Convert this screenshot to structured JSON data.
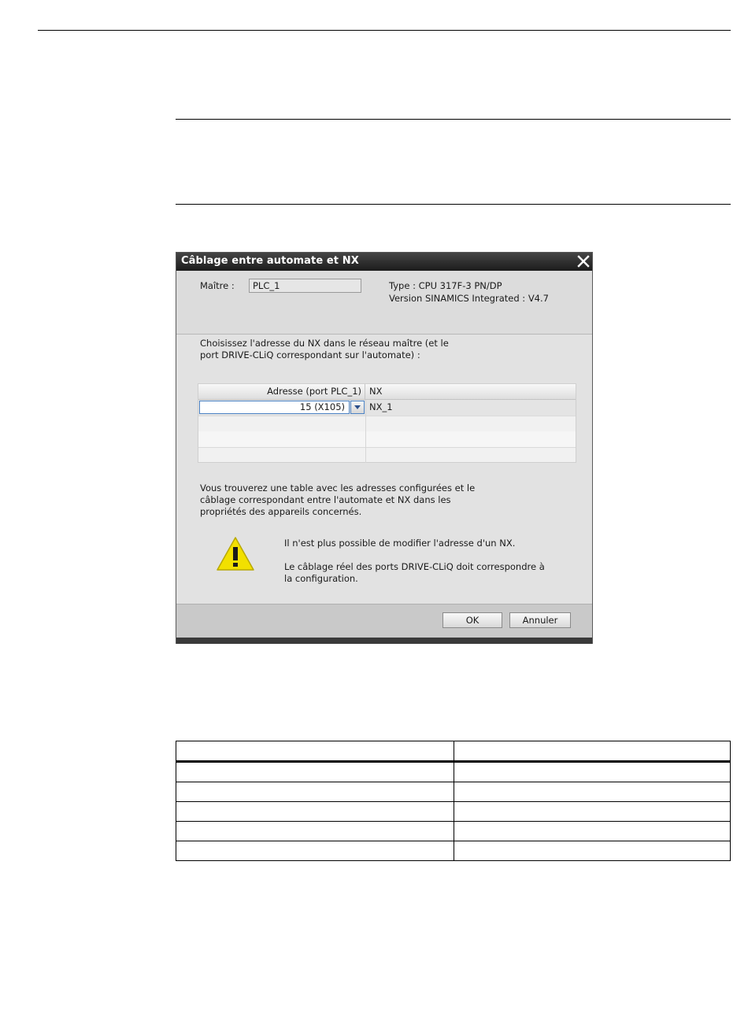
{
  "dialog": {
    "title": "Câblage entre automate et NX",
    "master_label": "Maître :",
    "master_value": "PLC_1",
    "type_text": "Type : CPU 317F-3 PN/DP",
    "version_text": "Version SINAMICS Integrated : V4.7",
    "instruction": "Choisissez l'adresse du NX dans le réseau maître (et le port DRIVE-CLiQ correspondant sur l'automate) :",
    "grid": {
      "headers": [
        "Adresse (port PLC_1)",
        "NX"
      ],
      "rows": [
        {
          "address": "15 (X105)",
          "nx": "NX_1"
        }
      ]
    },
    "note": "Vous trouverez une table avec les adresses configurées et le câblage correspondant entre l'automate et NX dans les propriétés des appareils concernés.",
    "warning_line1": "Il n'est plus possible de modifier l'adresse d'un NX.",
    "warning_line2": "Le câblage réel des ports DRIVE-CLiQ doit correspondre à la configuration.",
    "ok_label": "OK",
    "cancel_label": "Annuler"
  },
  "icons": {
    "close": "close-icon",
    "dropdown": "chevron-down-icon",
    "warning": "warning-icon"
  },
  "colors": {
    "titlebar": "#2a2a2a",
    "warning_fill": "#f2e000",
    "selection_border": "#4b82c4"
  }
}
